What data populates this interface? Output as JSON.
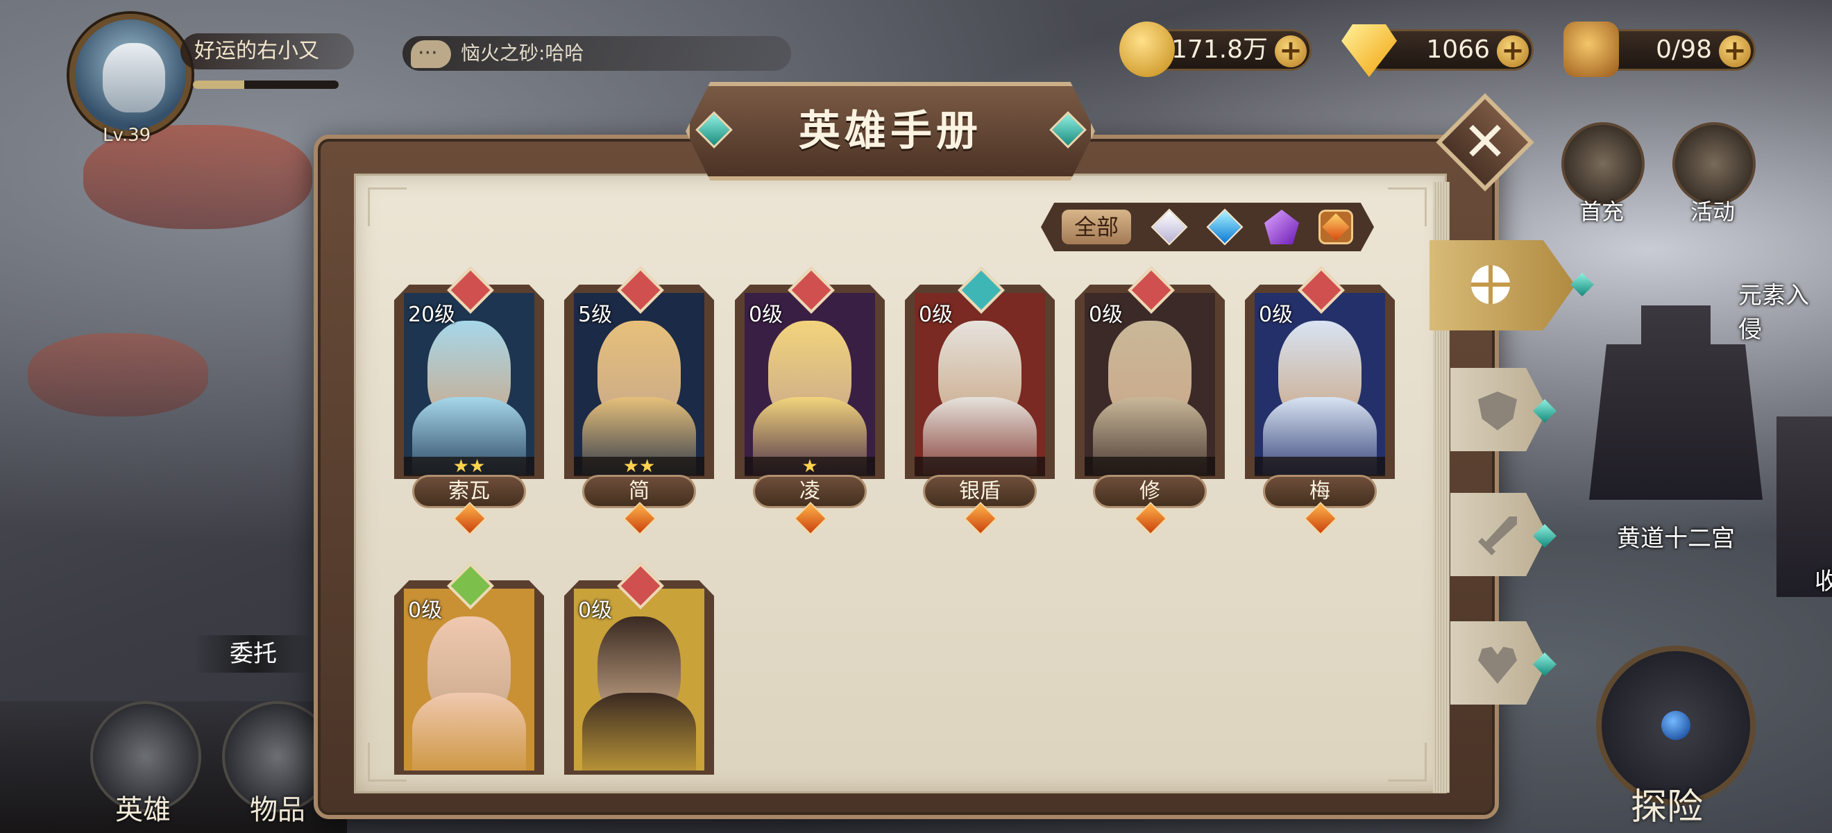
{
  "player": {
    "name": "好运的右小又",
    "level": "Lv.39",
    "exp_fraction": 0.35
  },
  "chat": {
    "message": "恼火之砂:哈哈"
  },
  "resources": {
    "gold": "171.8万",
    "gems": "1066",
    "stamina": "0/98",
    "plus": "+"
  },
  "top_right": {
    "first_recharge": "首充",
    "events": "活动"
  },
  "map": {
    "element_entry": "元素入侵",
    "zodiac": "黄道十二宫",
    "right_cut": "收",
    "entrust": "委托"
  },
  "bottom_nav": {
    "heroes": "英雄",
    "items": "物品",
    "explore": "探险"
  },
  "modal": {
    "title": "英雄手册",
    "close": "✕",
    "filter_all": "全部",
    "filters": [
      "white-gem",
      "blue-gem",
      "purple-gem",
      "orange-gem"
    ],
    "selected_filter": "orange-gem"
  },
  "side_tabs": [
    "grid-tab",
    "shield-tab",
    "sword-tab",
    "heart-tab"
  ],
  "heroes": [
    {
      "name": "索瓦",
      "level": "20级",
      "stars": "★★",
      "class": "warrior",
      "badge_color": "#d05050",
      "art": [
        "#a6d7ea",
        "#1d3550"
      ]
    },
    {
      "name": "简",
      "level": "5级",
      "stars": "★★",
      "class": "warrior",
      "badge_color": "#d05050",
      "art": [
        "#e6c07a",
        "#1b2a46"
      ]
    },
    {
      "name": "凌",
      "level": "0级",
      "stars": "★",
      "class": "warrior",
      "badge_color": "#d05050",
      "art": [
        "#f2d47c",
        "#3a1f44"
      ]
    },
    {
      "name": "银盾",
      "level": "0级",
      "stars": "",
      "class": "tank",
      "badge_color": "#3fb6b6",
      "art": [
        "#e6e2dc",
        "#7a2a22"
      ]
    },
    {
      "name": "修",
      "level": "0级",
      "stars": "",
      "class": "warrior",
      "badge_color": "#d05050",
      "art": [
        "#c9b898",
        "#3b2a28"
      ]
    },
    {
      "name": "梅",
      "level": "0级",
      "stars": "",
      "class": "warrior",
      "badge_color": "#d05050",
      "art": [
        "#d8e3f2",
        "#23306a"
      ]
    },
    {
      "name": "",
      "level": "0级",
      "stars": "",
      "class": "support",
      "badge_color": "#7cbf4a",
      "art": [
        "#f0c9b0",
        "#c99134"
      ]
    },
    {
      "name": "",
      "level": "0级",
      "stars": "",
      "class": "warrior",
      "badge_color": "#d05050",
      "art": [
        "#3a2a22",
        "#c9a23a"
      ]
    }
  ],
  "colors": {
    "gold_accent": "#d8bb78",
    "frame_brown": "#5a3f2f",
    "page_paper": "#ece5d5",
    "warrior_badge": "#d05050",
    "tank_badge": "#3fb6b6",
    "support_badge": "#7cbf4a"
  }
}
